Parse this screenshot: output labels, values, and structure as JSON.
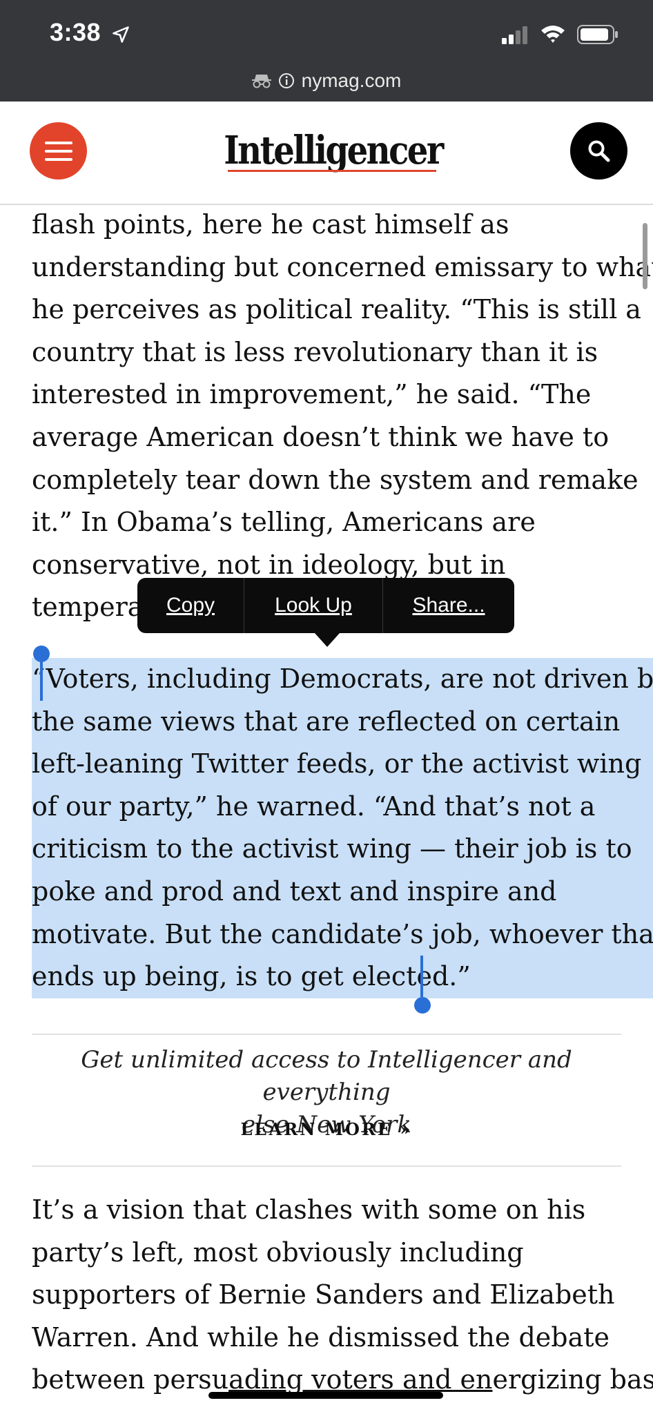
{
  "status_bar": {
    "time": "3:38",
    "location_icon": "location-arrow-icon",
    "signal_icon": "cellular-signal-icon",
    "wifi_icon": "wifi-icon",
    "battery_icon": "battery-icon"
  },
  "url_bar": {
    "private_icon": "private-browsing-icon",
    "info_icon": "info-icon",
    "domain": "nymag.com"
  },
  "header": {
    "menu_icon": "hamburger-menu-icon",
    "logo": "Intelligencer",
    "search_icon": "search-icon",
    "accent_color": "#e2442b"
  },
  "article": {
    "para1_lines": [
      "flash points, here he cast himself as",
      "understanding but concerned emissary to what",
      "he perceives as political reality. “This is still a",
      "country that is less revolutionary than it is",
      "interested in improvement,” he said. “The",
      "average American doesn’t think we have to",
      "completely tear down the system and remake",
      "it.” In Obama’s telling, Americans are",
      "conservative, not in ideology, but in",
      "tempera"
    ],
    "quote_lines": [
      "“Voters, including Democrats, are not driven by",
      "the same views that are reflected on certain",
      "left-leaning Twitter feeds, or the activist wing",
      "of our party,” he warned. “And that’s not a",
      "criticism to the activist wing — their job is to",
      "poke and prod and text and inspire and",
      "motivate. But the candidate’s job, whoever that",
      "ends up being, is to get elected.”"
    ],
    "selection_color": "#c8dff7",
    "para2_lines": [
      "It’s a vision that clashes with some on his",
      "party’s left, most obviously including",
      "supporters of Bernie Sanders and Elizabeth",
      "Warren. And while he dismissed the debate"
    ],
    "para2_last_line": {
      "prefix": "between persu",
      "link": "ading voters and en",
      "suffix": "ergizing base"
    }
  },
  "context_menu": {
    "copy": "Copy",
    "look_up": "Look Up",
    "share": "Share..."
  },
  "promo": {
    "text_line1": "Get unlimited access to Intelligencer and everything",
    "text_line2": "else New York",
    "cta": "LEARN MORE »"
  }
}
